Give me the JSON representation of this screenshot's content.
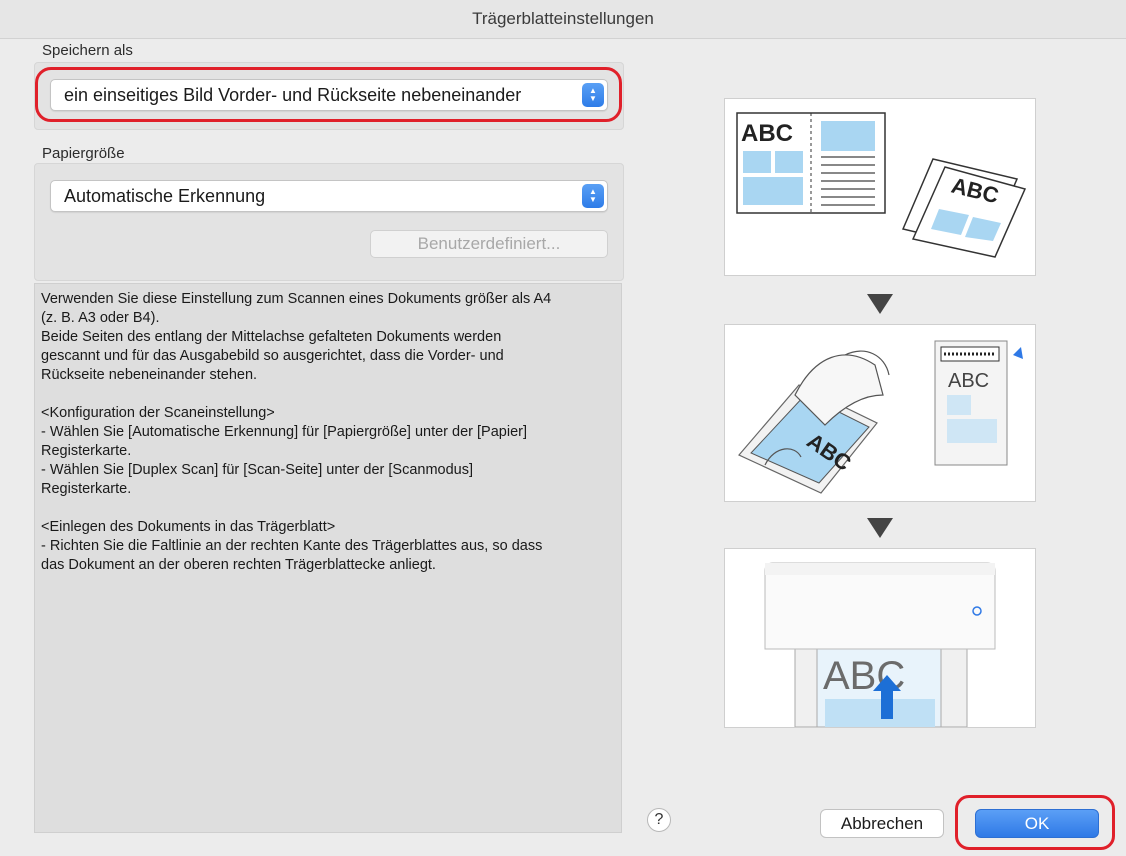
{
  "window": {
    "title": "Trägerblatteinstellungen"
  },
  "save_as": {
    "label": "Speichern als",
    "selected": "ein einseitiges Bild Vorder- und Rückseite nebeneinander"
  },
  "paper_size": {
    "label": "Papiergröße",
    "selected": "Automatische Erkennung",
    "custom_button": "Benutzerdefiniert..."
  },
  "description": {
    "p1": "Verwenden Sie diese Einstellung zum Scannen eines Dokuments größer als A4\n(z. B. A3 oder B4).\nBeide Seiten des entlang der Mittelachse gefalteten Dokuments werden\ngescannt und für das Ausgabebild so ausgerichtet, dass die Vorder- und\nRückseite nebeneinander stehen.",
    "p2": "<Konfiguration der Scaneinstellung>\n- Wählen Sie [Automatische Erkennung] für [Papiergröße] unter der [Papier]\nRegisterkarte.\n- Wählen Sie [Duplex Scan] für [Scan-Seite] unter der [Scanmodus]\nRegisterkarte.",
    "p3": "<Einlegen des Dokuments in das Trägerblatt>\n- Richten Sie die Faltlinie an der rechten Kante des Trägerblattes aus, so dass\ndas Dokument an der oberen rechten Trägerblattecke anliegt."
  },
  "illustration": {
    "text1": "ABC",
    "text2": "ABC",
    "text3": "ABC",
    "text4": "ABC"
  },
  "footer": {
    "help": "?",
    "cancel": "Abbrechen",
    "ok": "OK"
  },
  "colors": {
    "accent_blue": "#2f79e6",
    "highlight_red": "#e0202a",
    "illustration_blue": "#a9d6f2"
  }
}
